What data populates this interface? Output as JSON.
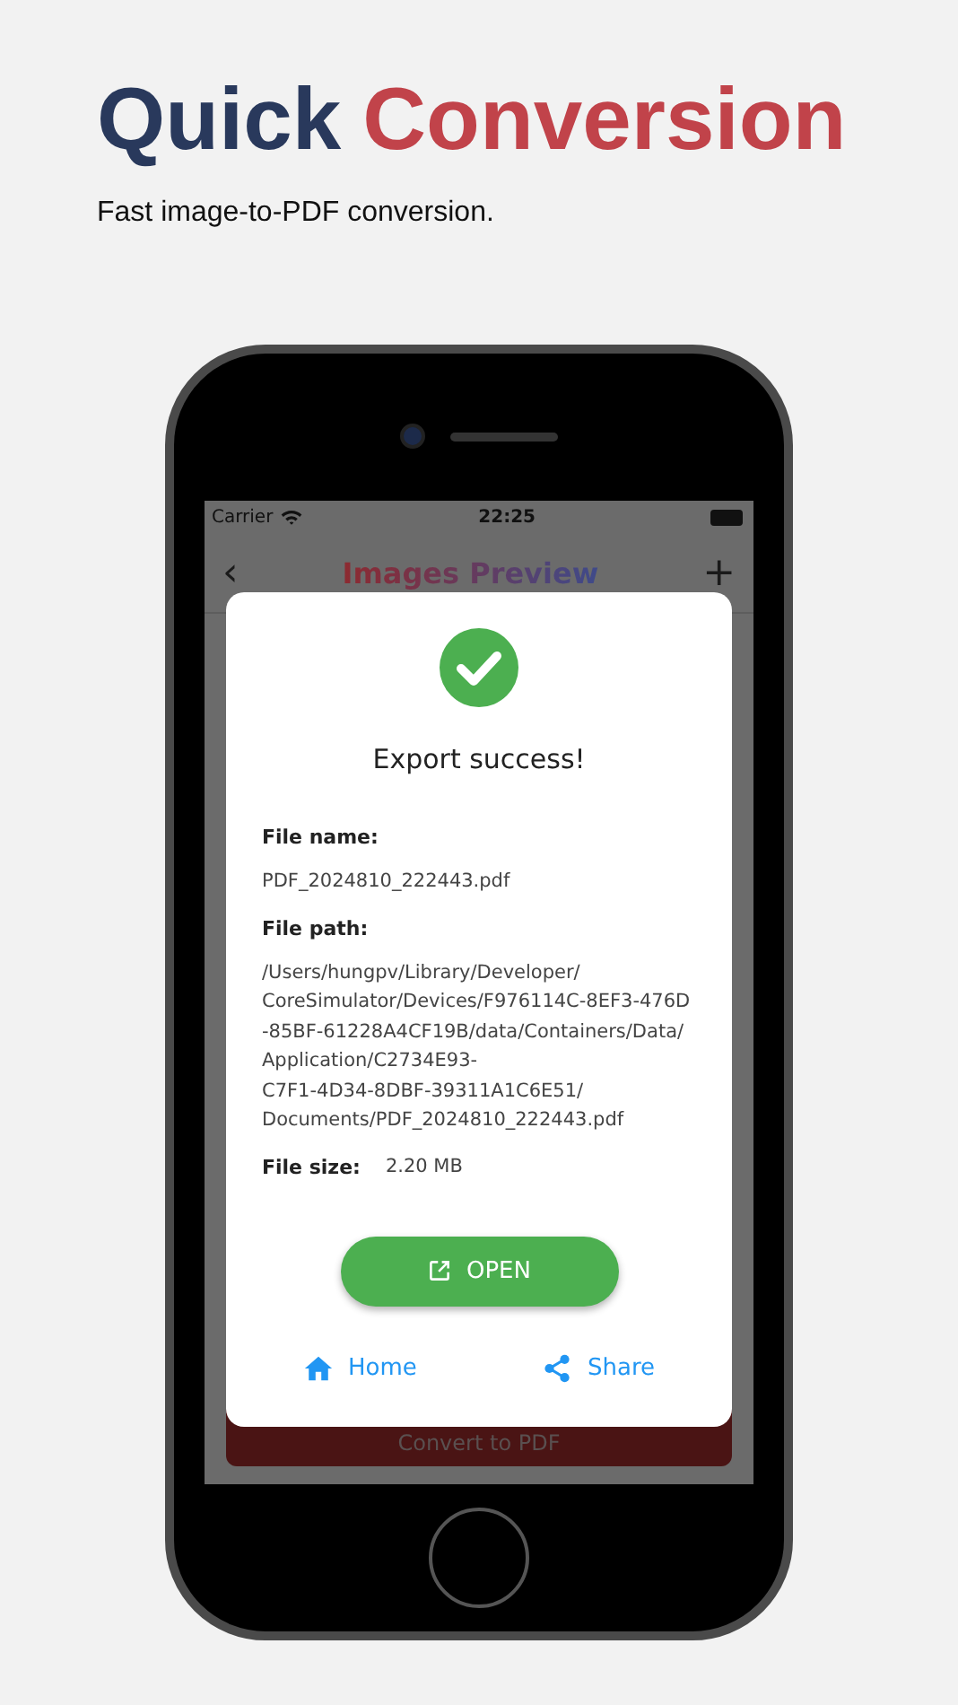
{
  "headline": [
    "Quick",
    "Conversion"
  ],
  "subtitle": "Fast image-to-PDF conversion.",
  "status_bar": {
    "carrier": "Carrier",
    "time": "22:25"
  },
  "nav": {
    "back": "‹",
    "title": "Images Preview",
    "add": "+"
  },
  "convert_button": "Convert to PDF",
  "dialog": {
    "title": "Export success!",
    "fields": [
      {
        "label": "File name:",
        "value": "PDF_2024810_222443.pdf",
        "inline": false
      },
      {
        "label": "File path:",
        "value": "/Users/hungpv/Library/Developer/\nCoreSimulator/Devices/F976114C-8EF3-476D\n-85BF-61228A4CF19B/data/Containers/Data/\nApplication/C2734E93-\nC7F1-4D34-8DBF-39311A1C6E51/\nDocuments/PDF_2024810_222443.pdf",
        "inline": false
      },
      {
        "label": "File size:",
        "value": "2.20 MB",
        "inline": true
      }
    ],
    "open_button": "OPEN",
    "actions": [
      {
        "kind": "home",
        "label": "Home"
      },
      {
        "kind": "share",
        "label": "Share"
      }
    ]
  }
}
